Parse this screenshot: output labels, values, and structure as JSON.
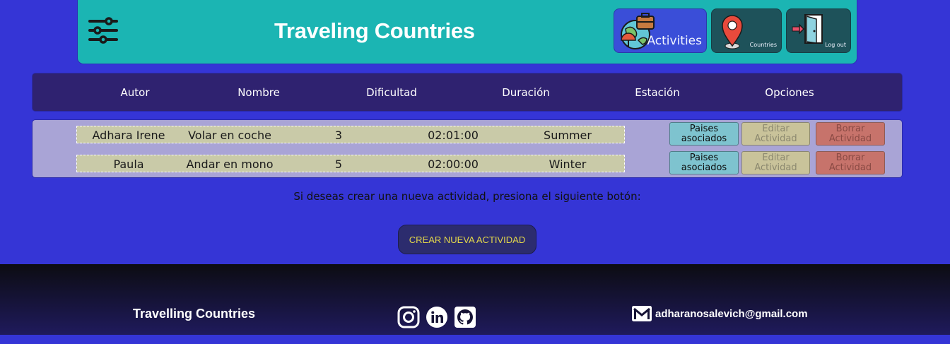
{
  "header": {
    "title": "Traveling Countries",
    "nav": {
      "activities_label": "Activities",
      "countries_label": "Countries",
      "logout_label": "Log out"
    },
    "icons": [
      "sliders-icon",
      "globe-suitcase-icon",
      "location-pin-icon",
      "exit-door-icon"
    ],
    "color": "#1bb5b3"
  },
  "table": {
    "columns": [
      "Autor",
      "Nombre",
      "Dificultad",
      "Duración",
      "Estación",
      "Opciones"
    ],
    "rows": [
      {
        "autor": "Adhara Irene",
        "nombre": "Volar en coche",
        "dificultad": "3",
        "duracion": "02:01:00",
        "estacion": "Summer"
      },
      {
        "autor": "Paula",
        "nombre": "Andar en mono",
        "dificultad": "5",
        "duracion": "02:00:00",
        "estacion": "Winter"
      }
    ],
    "actions": {
      "paises": [
        "Paises",
        "asociados"
      ],
      "editar": [
        "Editar",
        "Actividad"
      ],
      "borrar": [
        "Borrar",
        "Actividad"
      ]
    }
  },
  "info_text": "Si deseas crear una nueva actividad, presiona el siguiente botón:",
  "create_button": "CREAR NUEVA ACTIVIDAD",
  "footer": {
    "title": "Travelling Countries",
    "social_icons": [
      "instagram-icon",
      "linkedin-icon",
      "github-icon"
    ],
    "email": "adharanosalevich@gmail.com"
  },
  "colors": {
    "background": "#3535d6",
    "table_header": "#2f2270",
    "create_button_text": "#e4d84a"
  }
}
